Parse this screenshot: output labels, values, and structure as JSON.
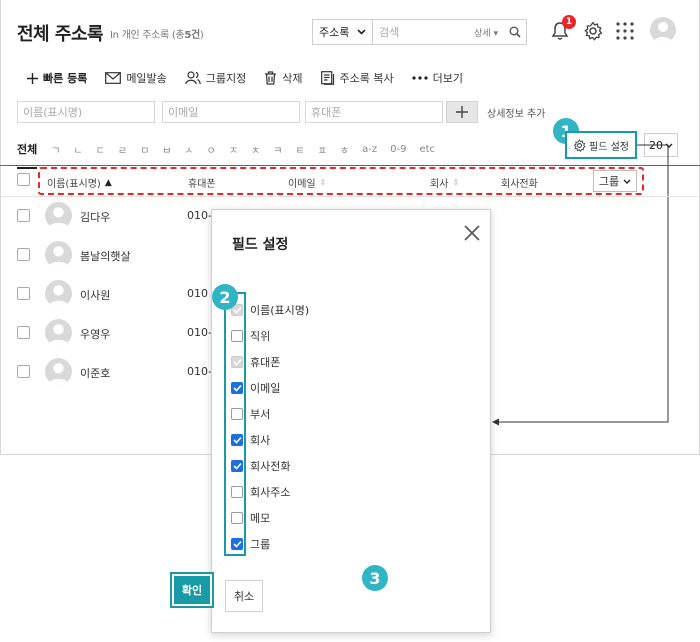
{
  "header": {
    "title": "전체 주소록",
    "subtitle_prefix": "In 개인 주소록 (총",
    "subtitle_count": "5건",
    "subtitle_suffix": ")"
  },
  "search": {
    "scope": "주소록",
    "placeholder": "검색",
    "detail_label": "상세"
  },
  "notifications": {
    "count": "1"
  },
  "toolbar": {
    "quick_add": "빠른 등록",
    "send_mail": "메일발송",
    "assign_group": "그룹지정",
    "delete": "삭제",
    "copy": "주소록 복사",
    "more": "더보기"
  },
  "filters": {
    "name": "이름(표시명)",
    "email": "이메일",
    "phone": "휴대폰",
    "add_detail": "상세정보 추가"
  },
  "index": {
    "all": "전체",
    "letters": [
      "ㄱ",
      "ㄴ",
      "ㄷ",
      "ㄹ",
      "ㅁ",
      "ㅂ",
      "ㅅ",
      "ㅇ",
      "ㅈ",
      "ㅊ",
      "ㅋ",
      "ㅌ",
      "ㅍ",
      "ㅎ",
      "a-z",
      "0-9",
      "etc"
    ]
  },
  "field_setting_button": "필드 설정",
  "page_size": "20",
  "steps": [
    "1",
    "2",
    "3"
  ],
  "columns": {
    "name": "이름(표시명)",
    "phone": "휴대폰",
    "email": "이메일",
    "company": "회사",
    "company_phone": "회사전화",
    "group": "그룹"
  },
  "rows": [
    {
      "name": "김다우",
      "phone": "010-"
    },
    {
      "name": "봄날의햇살",
      "phone": ""
    },
    {
      "name": "이사원",
      "phone": "010"
    },
    {
      "name": "우영우",
      "phone": "010-"
    },
    {
      "name": "이준호",
      "phone": "010-"
    }
  ],
  "modal": {
    "title": "필드 설정",
    "options": [
      {
        "label": "이름(표시명)",
        "state": "disabled"
      },
      {
        "label": "직위",
        "state": "off"
      },
      {
        "label": "휴대폰",
        "state": "disabled"
      },
      {
        "label": "이메일",
        "state": "on"
      },
      {
        "label": "부서",
        "state": "off"
      },
      {
        "label": "회사",
        "state": "on"
      },
      {
        "label": "회사전화",
        "state": "on"
      },
      {
        "label": "회사주소",
        "state": "off"
      },
      {
        "label": "메모",
        "state": "off"
      },
      {
        "label": "그룹",
        "state": "on"
      }
    ],
    "confirm": "확인",
    "cancel": "취소"
  },
  "colors": {
    "accent": "#189ba6",
    "step": "#2fb5c4",
    "checked": "#1d6fe0",
    "highlight_dashed": "#e4282b",
    "badge": "#e8272c"
  }
}
